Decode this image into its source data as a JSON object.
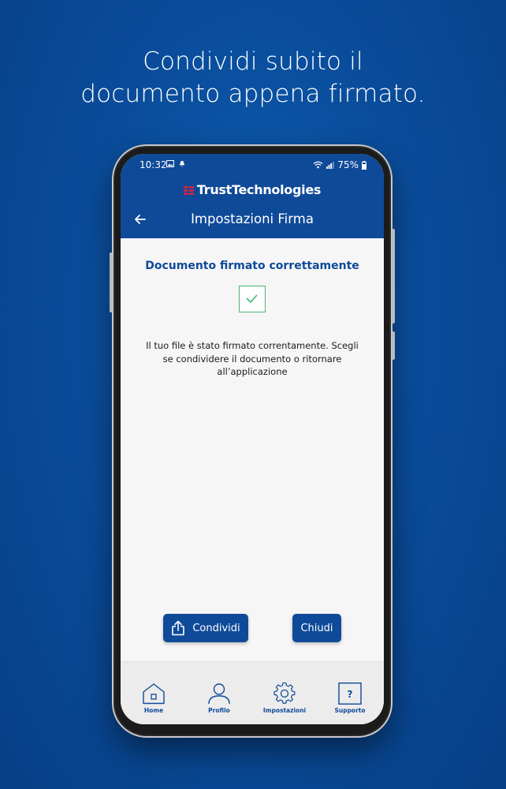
{
  "headline": {
    "line1": "Condividi subito il",
    "line2": "documento appena firmato."
  },
  "status_bar": {
    "time": "10:32",
    "battery": "75%"
  },
  "app": {
    "brand": "TrustTechnologies",
    "screen_title": "Impostazioni Firma"
  },
  "result": {
    "title": "Documento firmato correttamente",
    "message": "Il tuo file è stato firmato correntamente. Scegli se condividere il documento o ritornare all’applicazione"
  },
  "actions": {
    "share_label": "Condividi",
    "close_label": "Chiudi"
  },
  "tabs": [
    {
      "label": "Home",
      "icon": "home-icon"
    },
    {
      "label": "Profilo",
      "icon": "profile-icon"
    },
    {
      "label": "Impostazioni",
      "icon": "gear-icon"
    },
    {
      "label": "Supporto",
      "icon": "help-icon"
    }
  ],
  "colors": {
    "primary": "#0f4a99",
    "success": "#49b373",
    "brand_mark": "#e5203c",
    "background": "#0a4d9c"
  }
}
